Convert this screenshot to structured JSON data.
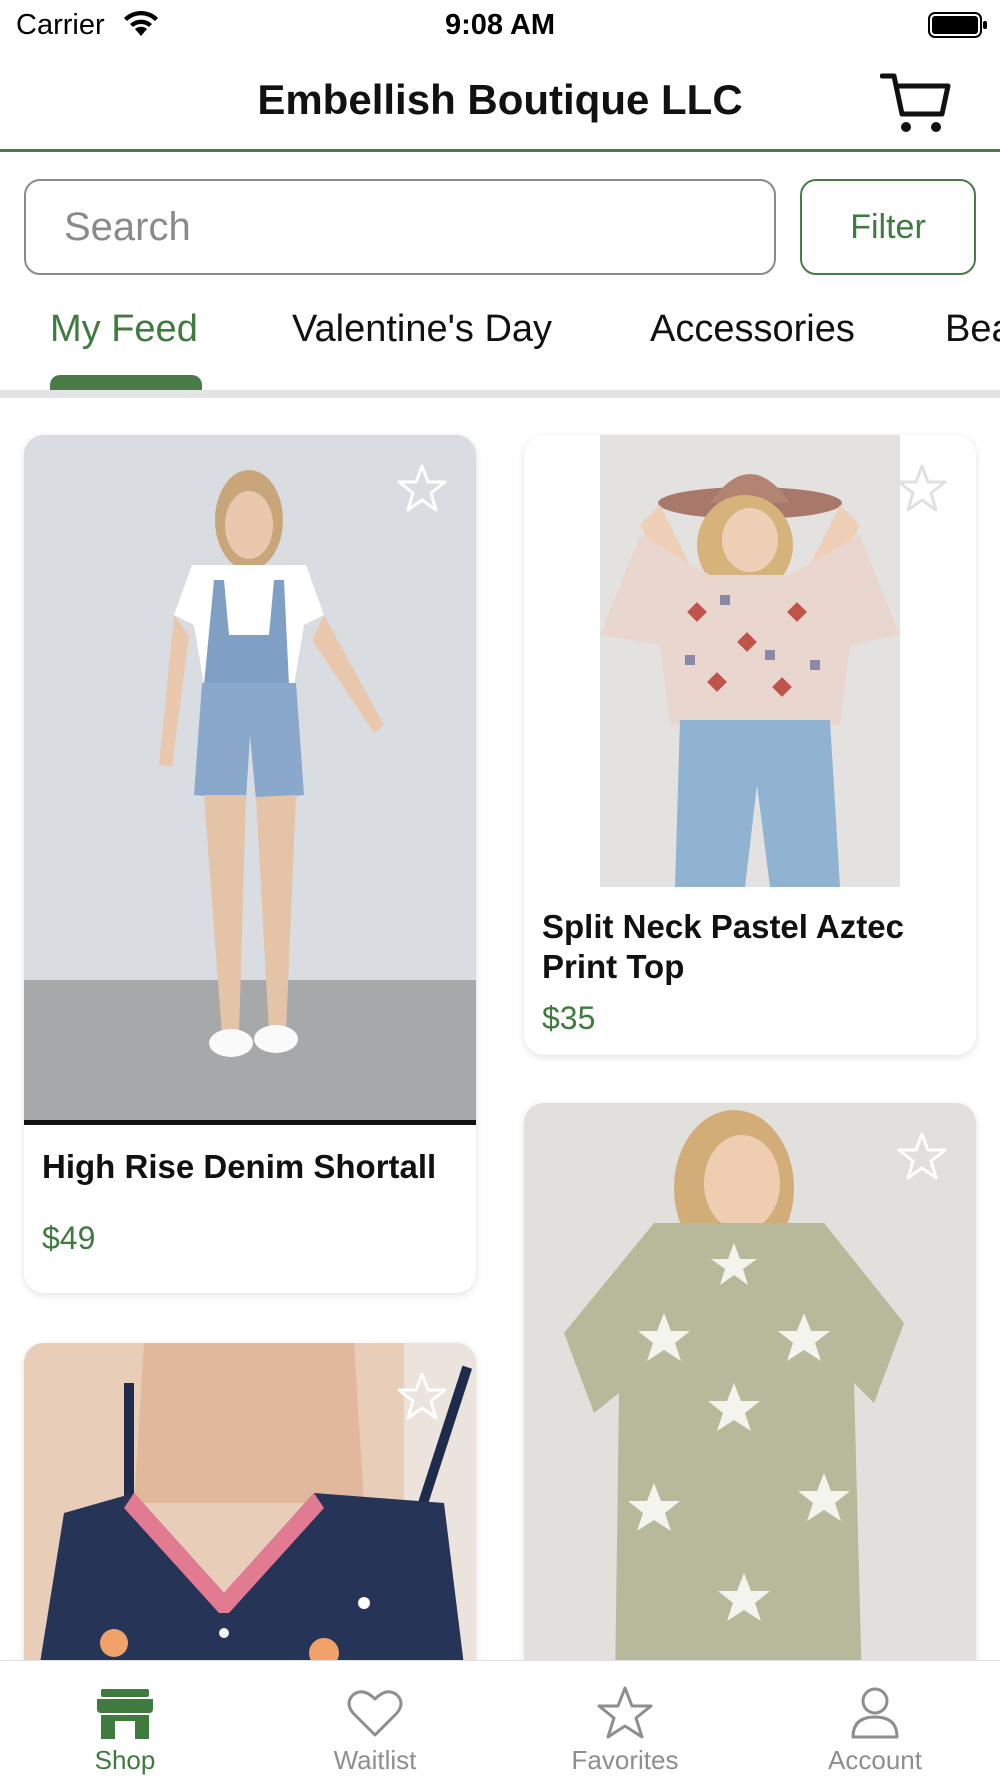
{
  "status_bar": {
    "carrier": "Carrier",
    "time": "9:08 AM"
  },
  "header": {
    "title": "Embellish Boutique LLC",
    "cart_icon": "cart-icon"
  },
  "search": {
    "placeholder": "Search",
    "value": "",
    "filter_label": "Filter"
  },
  "categories": {
    "active": "My Feed",
    "tabs": [
      "My Feed",
      "Valentine's Day",
      "Accessories",
      "Bea"
    ]
  },
  "products": [
    {
      "name": "High Rise Denim Shortall",
      "price": "$49",
      "favorited": false
    },
    {
      "name": "Split Neck Pastel Aztec Print Top",
      "price": "$35",
      "favorited": false
    },
    {
      "name": "",
      "price": "",
      "favorited": false
    },
    {
      "name": "",
      "price": "",
      "favorited": false
    }
  ],
  "tab_bar": {
    "active": "Shop",
    "items": [
      {
        "label": "Shop",
        "icon": "storefront-icon"
      },
      {
        "label": "Waitlist",
        "icon": "heart-icon"
      },
      {
        "label": "Favorites",
        "icon": "star-icon"
      },
      {
        "label": "Account",
        "icon": "person-icon"
      }
    ]
  },
  "colors": {
    "accent": "#3f7a3e",
    "inactive": "#8e8e8e",
    "divider": "#e4e4e4"
  }
}
